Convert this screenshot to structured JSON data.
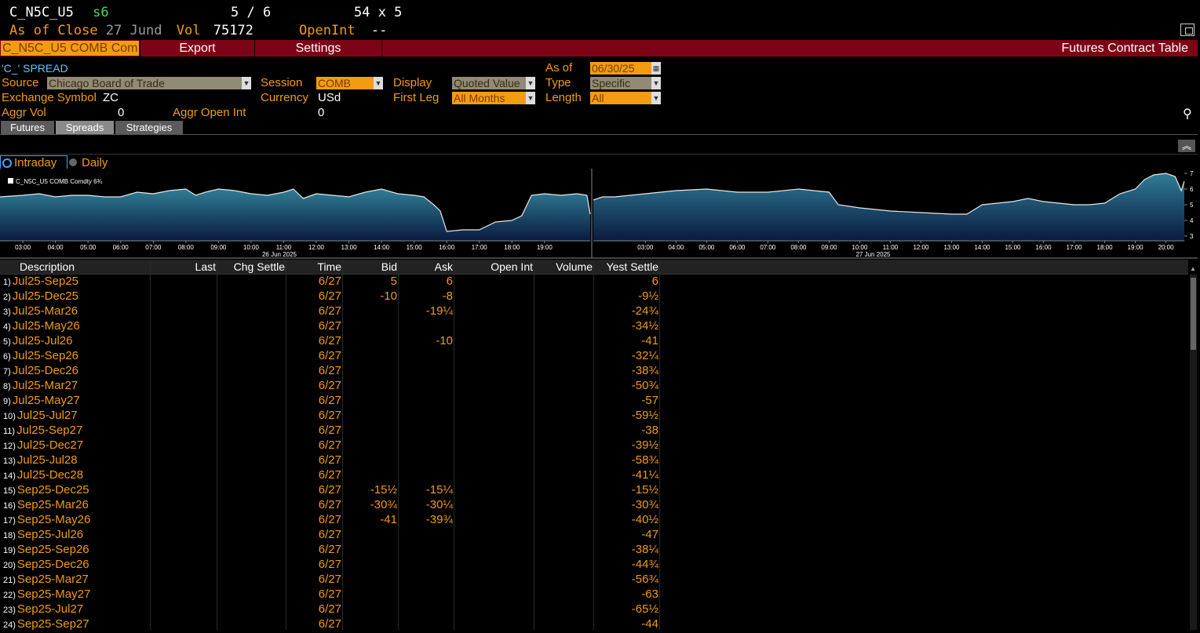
{
  "header": {
    "ticker": "C_N5C_U5",
    "s_label": "s6",
    "page": "5 / 6",
    "grid": "54 x 5",
    "as_of_close": "As of Close",
    "close_date": "27 Jund",
    "vol_label": "Vol",
    "vol_value": "75172",
    "openint_label": "OpenInt",
    "openint_value": "--"
  },
  "toolbar": {
    "security": "C_N5C_U5 COMB Com",
    "export": "Export",
    "settings": "Settings",
    "title": "Futures Contract Table"
  },
  "filters": {
    "spread_name": "'C_' SPREAD",
    "as_of_label": "As of",
    "as_of_value": "06/30/25",
    "source_label": "Source",
    "source_value": "Chicago Board of Trade",
    "session_label": "Session",
    "session_value": "COMB",
    "display_label": "Display",
    "display_value": "Quoted Value",
    "type_label": "Type",
    "type_value": "Specific",
    "exch_label": "Exchange Symbol",
    "exch_value": "ZC",
    "currency_label": "Currency",
    "currency_value": "USd",
    "firstleg_label": "First Leg",
    "firstleg_value": "All Months",
    "length_label": "Length",
    "length_value": "All",
    "aggrvol_label": "Aggr Vol",
    "aggrvol_value": "0",
    "aggroi_label": "Aggr Open Int",
    "aggroi_value": "0"
  },
  "tabs": [
    "Futures",
    "Spreads",
    "Strategies"
  ],
  "chart_toggle": {
    "intraday": "Intraday",
    "daily": "Daily"
  },
  "chart_data": {
    "type": "area",
    "legend": "C_N5C_U5 COMB Comdty  6¾",
    "colors": {
      "line": "#e8e8e8",
      "fill_top": "#2f7d95",
      "fill_bottom": "#0a1a40"
    },
    "ylim": [
      2.7,
      7.3
    ],
    "y_ticks": [
      "3",
      "4",
      "5",
      "6",
      "7"
    ],
    "panels": [
      {
        "date_label": "26 Jun 2025",
        "x_ticks": [
          "03:00",
          "04:00",
          "05:00",
          "06:00",
          "07:00",
          "08:00",
          "09:00",
          "10:00",
          "11:00",
          "12:00",
          "13:00",
          "14:00",
          "15:00",
          "16:00",
          "17:00",
          "18:00",
          "19:00"
        ],
        "x_range": [
          2.3,
          20.4
        ],
        "x": [
          2.3,
          3.0,
          3.5,
          4.0,
          4.5,
          5.0,
          5.5,
          6.0,
          6.5,
          7.0,
          7.5,
          8.0,
          8.3,
          8.6,
          9.0,
          9.5,
          10.0,
          10.5,
          11.0,
          11.3,
          11.6,
          12.0,
          12.5,
          13.0,
          13.5,
          14.0,
          14.5,
          15.0,
          15.3,
          15.6,
          15.8,
          16.0,
          16.5,
          17.0,
          17.5,
          18.0,
          18.3,
          18.6,
          19.0,
          19.5,
          20.0,
          20.3,
          20.4
        ],
        "y": [
          5.5,
          5.6,
          5.7,
          5.5,
          5.6,
          5.6,
          5.5,
          5.5,
          5.8,
          5.7,
          5.9,
          6.0,
          5.6,
          5.8,
          6.0,
          5.9,
          5.7,
          5.6,
          5.8,
          6.0,
          5.4,
          5.7,
          5.6,
          5.5,
          5.8,
          6.0,
          5.7,
          5.6,
          5.5,
          5.0,
          4.6,
          3.3,
          3.4,
          3.4,
          3.9,
          4.0,
          4.3,
          5.6,
          5.7,
          5.6,
          5.7,
          5.6,
          4.4
        ]
      },
      {
        "date_label": "27 Jun 2025",
        "x_ticks": [
          "03:00",
          "04:00",
          "05:00",
          "06:00",
          "07:00",
          "08:00",
          "09:00",
          "10:00",
          "11:00",
          "12:00",
          "13:00",
          "14:00",
          "15:00",
          "16:00",
          "17:00",
          "18:00",
          "19:00",
          "20:00"
        ],
        "x_range": [
          1.3,
          20.6
        ],
        "x": [
          1.3,
          1.6,
          2.0,
          3.0,
          4.0,
          5.0,
          6.0,
          7.0,
          8.0,
          9.0,
          9.3,
          10.0,
          10.5,
          11.0,
          12.0,
          13.0,
          13.5,
          14.0,
          14.5,
          15.0,
          15.5,
          16.0,
          16.5,
          17.0,
          17.5,
          18.0,
          18.5,
          19.0,
          19.3,
          19.6,
          20.0,
          20.3,
          20.5,
          20.6
        ],
        "y": [
          5.3,
          5.5,
          5.5,
          5.7,
          5.9,
          6.0,
          5.8,
          5.8,
          6.0,
          5.8,
          5.0,
          4.8,
          4.7,
          4.6,
          4.5,
          4.4,
          4.4,
          5.0,
          5.1,
          5.2,
          5.4,
          5.2,
          5.1,
          5.0,
          5.0,
          5.1,
          5.7,
          6.0,
          6.6,
          6.9,
          7.0,
          6.8,
          5.9,
          6.5
        ]
      }
    ]
  },
  "table": {
    "columns": [
      "Description",
      "Last",
      "Chg Settle",
      "Time",
      "Bid",
      "Ask",
      "Open Int",
      "Volume",
      "Yest Settle"
    ],
    "rows": [
      {
        "n": "1)",
        "desc": "Jul25-Sep25",
        "time": "6/27",
        "bid": "5",
        "ask": "6",
        "ys": "6"
      },
      {
        "n": "2)",
        "desc": "Jul25-Dec25",
        "time": "6/27",
        "bid": "-10",
        "ask": "-8",
        "ys": "-9½"
      },
      {
        "n": "3)",
        "desc": "Jul25-Mar26",
        "time": "6/27",
        "bid": "",
        "ask": "-19¼",
        "ys": "-24¾"
      },
      {
        "n": "4)",
        "desc": "Jul25-May26",
        "time": "6/27",
        "bid": "",
        "ask": "",
        "ys": "-34½"
      },
      {
        "n": "5)",
        "desc": "Jul25-Jul26",
        "time": "6/27",
        "bid": "",
        "ask": "-10",
        "ys": "-41"
      },
      {
        "n": "6)",
        "desc": "Jul25-Sep26",
        "time": "6/27",
        "bid": "",
        "ask": "",
        "ys": "-32¼"
      },
      {
        "n": "7)",
        "desc": "Jul25-Dec26",
        "time": "6/27",
        "bid": "",
        "ask": "",
        "ys": "-38¾"
      },
      {
        "n": "8)",
        "desc": "Jul25-Mar27",
        "time": "6/27",
        "bid": "",
        "ask": "",
        "ys": "-50¾"
      },
      {
        "n": "9)",
        "desc": "Jul25-May27",
        "time": "6/27",
        "bid": "",
        "ask": "",
        "ys": "-57"
      },
      {
        "n": "10)",
        "desc": "Jul25-Jul27",
        "time": "6/27",
        "bid": "",
        "ask": "",
        "ys": "-59½"
      },
      {
        "n": "11)",
        "desc": "Jul25-Sep27",
        "time": "6/27",
        "bid": "",
        "ask": "",
        "ys": "-38"
      },
      {
        "n": "12)",
        "desc": "Jul25-Dec27",
        "time": "6/27",
        "bid": "",
        "ask": "",
        "ys": "-39½"
      },
      {
        "n": "13)",
        "desc": "Jul25-Jul28",
        "time": "6/27",
        "bid": "",
        "ask": "",
        "ys": "-58¾"
      },
      {
        "n": "14)",
        "desc": "Jul25-Dec28",
        "time": "6/27",
        "bid": "",
        "ask": "",
        "ys": "-41¼"
      },
      {
        "n": "15)",
        "desc": "Sep25-Dec25",
        "time": "6/27",
        "bid": "-15½",
        "ask": "-15¼",
        "ys": "-15½"
      },
      {
        "n": "16)",
        "desc": "Sep25-Mar26",
        "time": "6/27",
        "bid": "-30¾",
        "ask": "-30¼",
        "ys": "-30¾"
      },
      {
        "n": "17)",
        "desc": "Sep25-May26",
        "time": "6/27",
        "bid": "-41",
        "ask": "-39¾",
        "ys": "-40½"
      },
      {
        "n": "18)",
        "desc": "Sep25-Jul26",
        "time": "6/27",
        "bid": "",
        "ask": "",
        "ys": "-47"
      },
      {
        "n": "19)",
        "desc": "Sep25-Sep26",
        "time": "6/27",
        "bid": "",
        "ask": "",
        "ys": "-38¼"
      },
      {
        "n": "20)",
        "desc": "Sep25-Dec26",
        "time": "6/27",
        "bid": "",
        "ask": "",
        "ys": "-44¾"
      },
      {
        "n": "21)",
        "desc": "Sep25-Mar27",
        "time": "6/27",
        "bid": "",
        "ask": "",
        "ys": "-56¾"
      },
      {
        "n": "22)",
        "desc": "Sep25-May27",
        "time": "6/27",
        "bid": "",
        "ask": "",
        "ys": "-63"
      },
      {
        "n": "23)",
        "desc": "Sep25-Jul27",
        "time": "6/27",
        "bid": "",
        "ask": "",
        "ys": "-65½"
      },
      {
        "n": "24)",
        "desc": "Sep25-Sep27",
        "time": "6/27",
        "bid": "",
        "ask": "",
        "ys": "-44"
      }
    ]
  }
}
